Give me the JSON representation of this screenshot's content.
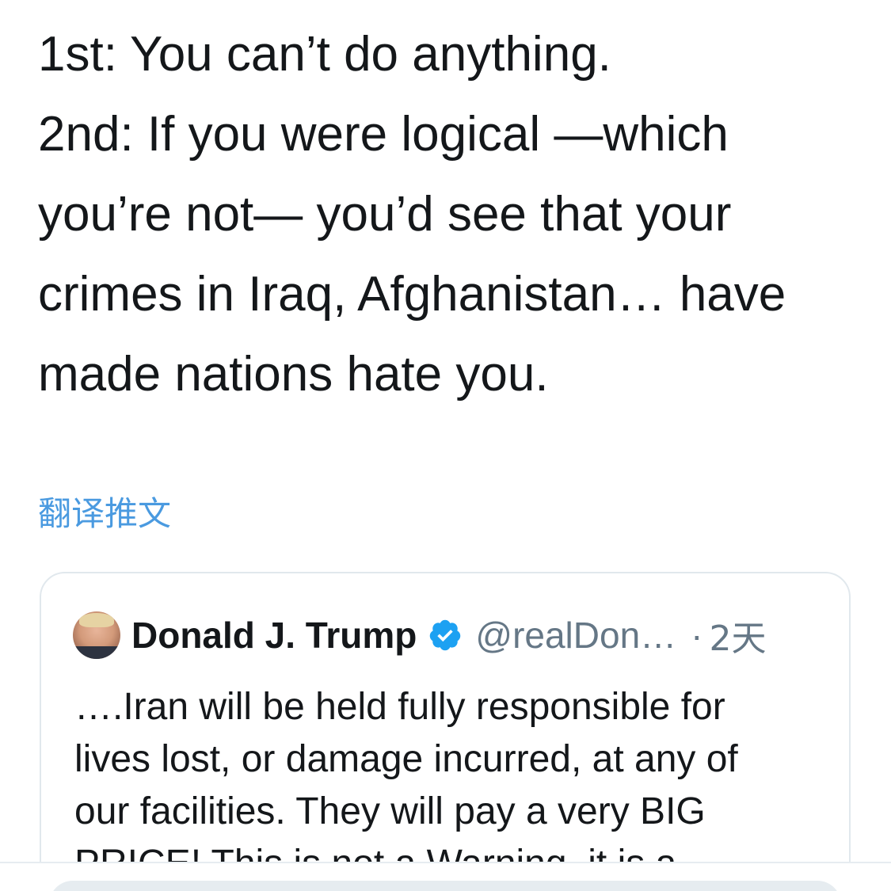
{
  "tweet": {
    "text_lines": [
      "1st: You can’t do anything.",
      "2nd: If you were logical —which",
      "you’re not— you’d see that your",
      "crimes in Iraq, Afghanistan… have",
      "made nations hate you."
    ],
    "translate_label": "翻译推文"
  },
  "quoted_tweet": {
    "author_name": "Donald J. Trump",
    "handle": "@realDon…",
    "separator": "·",
    "time": "2天",
    "verified": true,
    "avatar_icon": "profile-photo",
    "body_lines": [
      "….Iran will be held fully responsible for",
      "lives lost, or damage incurred, at any of",
      "our facilities. They will pay a very BIG",
      "PRICE! This is not a Warning, it is a"
    ]
  },
  "colors": {
    "text": "#14171a",
    "link": "#4a9ae0",
    "secondary": "#657786",
    "verified": "#1da1f2",
    "border": "#e1e8ed"
  }
}
